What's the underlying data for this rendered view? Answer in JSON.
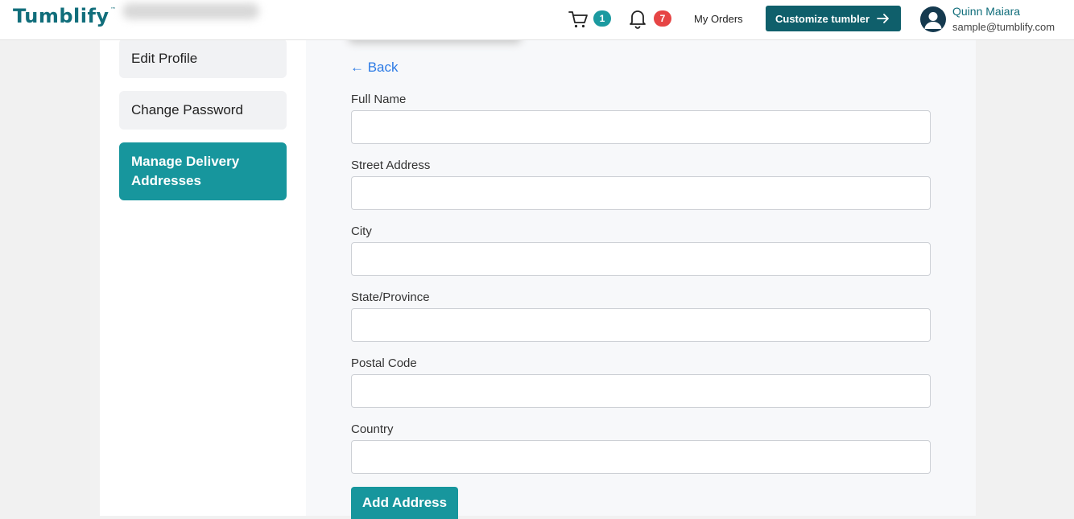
{
  "header": {
    "logo_text": "Tumblify",
    "logo_mark": "™",
    "cart_icon": "cart-icon",
    "cart_count": "1",
    "bell_icon": "bell-icon",
    "notification_count": "7",
    "my_orders_label": "My Orders",
    "customize_label": "Customize tumbler",
    "customize_icon": "arrow-right-icon",
    "user": {
      "avatar_icon": "user-avatar-icon",
      "name": "Quinn Maiara",
      "email": "sample@tumblify.com"
    }
  },
  "sidebar": {
    "items": [
      {
        "label": "Edit Profile",
        "active": false
      },
      {
        "label": "Change Password",
        "active": false
      },
      {
        "label": "Manage Delivery Addresses",
        "active": true
      }
    ]
  },
  "form": {
    "back_label": "← Back",
    "fields": [
      {
        "label": "Full Name",
        "value": "",
        "placeholder": ""
      },
      {
        "label": "Street Address",
        "value": "",
        "placeholder": ""
      },
      {
        "label": "City",
        "value": "",
        "placeholder": ""
      },
      {
        "label": "State/Province",
        "value": "",
        "placeholder": ""
      },
      {
        "label": "Postal Code",
        "value": "",
        "placeholder": ""
      },
      {
        "label": "Country",
        "value": "",
        "placeholder": ""
      }
    ],
    "submit_label": "Add Address"
  },
  "colors": {
    "brand": "#116e7b",
    "accent": "#17969d",
    "button_dark": "#0f5f6b",
    "alert_badge": "#e64545",
    "link": "#2d7be5"
  }
}
